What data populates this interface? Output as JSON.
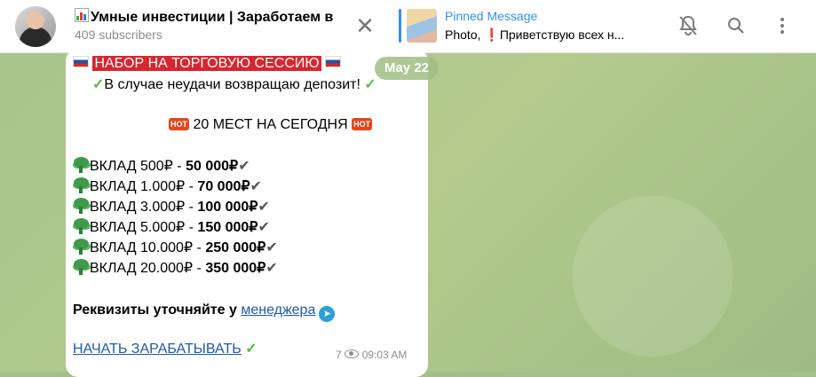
{
  "header": {
    "title": "Умные инвестиции | Заработаем в",
    "subscribers": "409 subscribers",
    "close_glyph": "✕"
  },
  "pinned": {
    "label": "Pinned Message",
    "prefix": "Photo,",
    "exclamation": "❗",
    "text": "Приветствую всех н..."
  },
  "icons": {
    "mute": "bell-off-icon",
    "search": "search-icon",
    "menu": "more-vertical-icon"
  },
  "date_badge": "May 22",
  "message": {
    "banner": "НАБОР НА ТОРГОВУЮ СЕССИЮ",
    "refund": "В случае неудачи возвращаю депозит!",
    "check": "✓",
    "hot": "HOT",
    "places": "20 МЕСТ НА СЕГОДНЯ",
    "deposits": [
      {
        "label": "ВКЛАД 500₽ - ",
        "result": "50 000₽"
      },
      {
        "label": "ВКЛАД 1.000₽ - ",
        "result": "70 000₽"
      },
      {
        "label": "ВКЛАД 3.000₽ - ",
        "result": "100 000₽"
      },
      {
        "label": "ВКЛАД 5.000₽ - ",
        "result": "150 000₽"
      },
      {
        "label": "ВКЛАД 10.000₽ - ",
        "result": "250 000₽"
      },
      {
        "label": "ВКЛАД 20.000₽ - ",
        "result": "350 000₽"
      }
    ],
    "tick": "✔",
    "details_prefix": "Реквизиты уточняйте у ",
    "manager_link": "менеджера",
    "cta_link": "НАЧАТЬ ЗАРАБАТЫВАТЬ",
    "views": "7",
    "time": "09:03 AM"
  }
}
